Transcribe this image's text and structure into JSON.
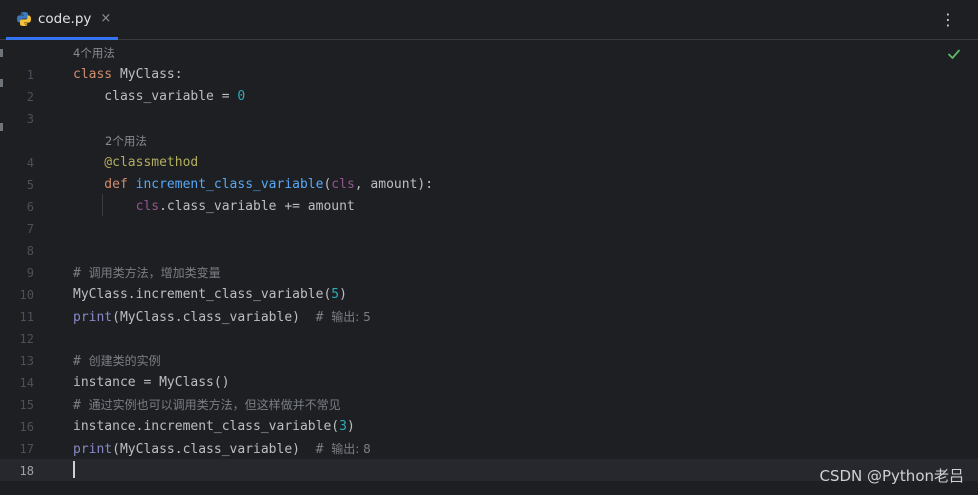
{
  "tab": {
    "filename": "code.py",
    "close_glyph": "×",
    "icon": "python-icon"
  },
  "menu_glyph": "⋮",
  "status": {
    "icon": "check-icon",
    "color": "#5fb865"
  },
  "hints": {
    "class_usages": "4个用法",
    "method_usages": "2个用法"
  },
  "line_numbers": [
    "1",
    "2",
    "3",
    "4",
    "5",
    "6",
    "7",
    "8",
    "9",
    "10",
    "11",
    "12",
    "13",
    "14",
    "15",
    "16",
    "17",
    "18"
  ],
  "code": {
    "l1": {
      "kw": "class",
      "rest": " MyClass:"
    },
    "l2": {
      "text": "    class_variable = ",
      "num": "0"
    },
    "l4": {
      "text": "    @classmethod"
    },
    "l5": {
      "kw": "    def",
      "fn": " increment_class_variable",
      "p1": "(",
      "cls": "cls",
      "p2": ", amount):"
    },
    "l6": {
      "cls": "        cls",
      "rest": ".class_variable += amount"
    },
    "l9": {
      "hash": "# ",
      "text": "调用类方法，增加类变量"
    },
    "l10": {
      "text": "MyClass.increment_class_variable(",
      "num": "5",
      "close": ")"
    },
    "l11": {
      "bi": "print",
      "text": "(MyClass.class_variable)  ",
      "hash": "# ",
      "comment": "输出: 5"
    },
    "l13": {
      "hash": "# ",
      "text": "创建类的实例"
    },
    "l14": {
      "text": "instance = MyClass()"
    },
    "l15": {
      "hash": "# ",
      "text": "通过实例也可以调用类方法，但这样做并不常见"
    },
    "l16": {
      "text": "instance.increment_class_variable(",
      "num": "3",
      "close": ")"
    },
    "l17": {
      "bi": "print",
      "text": "(MyClass.class_variable)  ",
      "hash": "# ",
      "comment": "输出: 8"
    }
  },
  "watermark": "CSDN @Python老吕"
}
